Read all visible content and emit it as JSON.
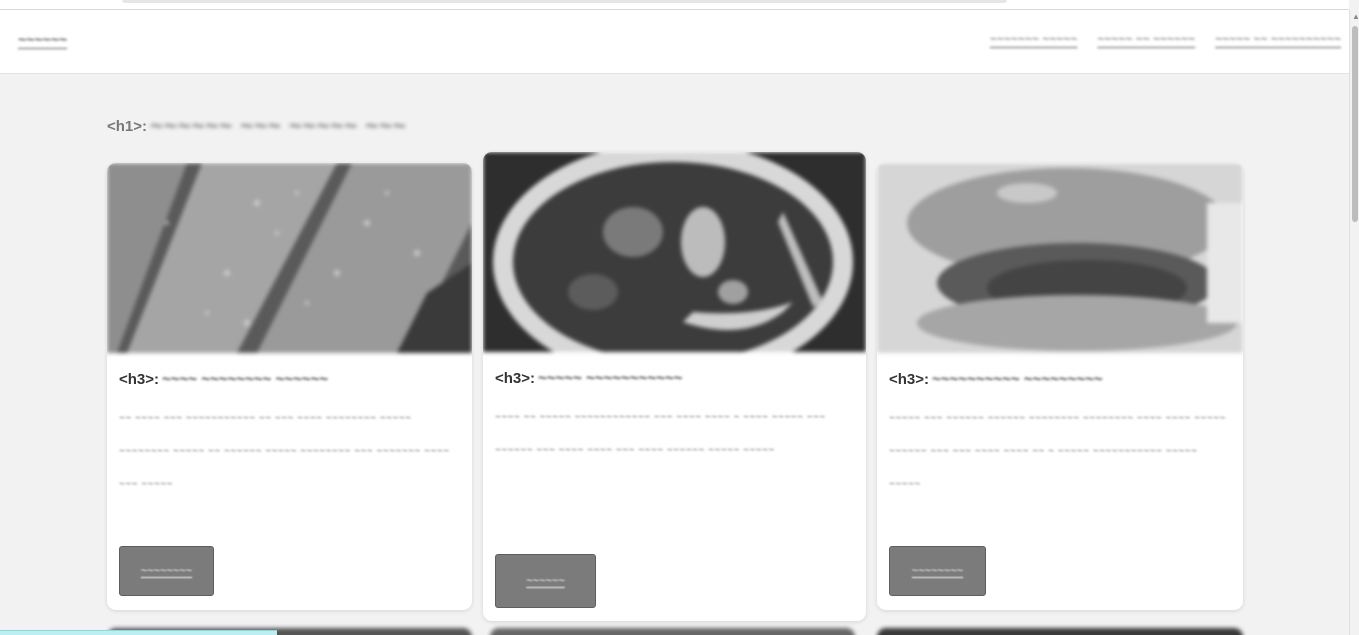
{
  "header": {
    "logo": "~~~~~~",
    "nav": [
      "~~~~~~~ ~~~~~",
      "~~~~~ ~~ ~~~~~~",
      "~~~~~ ~~ ~~~~~~~~~~"
    ]
  },
  "main": {
    "title_tag": "<h1>:",
    "title": "~~~~~~ ~~~ ~~~~~ ~~~"
  },
  "cards": [
    {
      "h3_tag": "<h3>:",
      "h3": "~~~~ ~~~~~~~~ ~~~~~~",
      "body": "~~ ~~~~ ~~~ ~~~~~~~~~~~ ~~ ~~~ ~~~~ ~~~~~~~~ ~~~~~ ~~~~~~~~ ~~~~~ ~~ ~~~~~~ ~~~~~ ~~~~~~~~ ~~~ ~~~~~~~ ~~~~ ~~~ ~~~~~",
      "button": "~~~~~~~~"
    },
    {
      "h3_tag": "<h3>:",
      "h3": "~~~~~ ~~~~~~~~~~~",
      "body": "~~~~ ~~ ~~~~~ ~~~~~~~~~~~~ ~~~ ~~~~ ~~~~ ~ ~~~~ ~~~~~ ~~~ ~~~~~~ ~~~ ~~~~ ~~~~ ~~~ ~~~~ ~~~~~~ ~~~~~ ~~~~~",
      "button": "~~~~~~"
    },
    {
      "h3_tag": "<h3>:",
      "h3": "~~~~~~~~~~ ~~~~~~~~~",
      "body": "~~~~~ ~~~ ~~~~~~ ~~~~~~ ~~~~~~~~ ~~~~~~~~ ~~~~ ~~~~ ~~~~~ ~~~~~~ ~~~ ~~~ ~~~~ ~~~~ ~~ ~ ~~~~~ ~~~~~~~~~~~ ~~~~~ ~~~~~",
      "button": "~~~~~~~~"
    }
  ]
}
